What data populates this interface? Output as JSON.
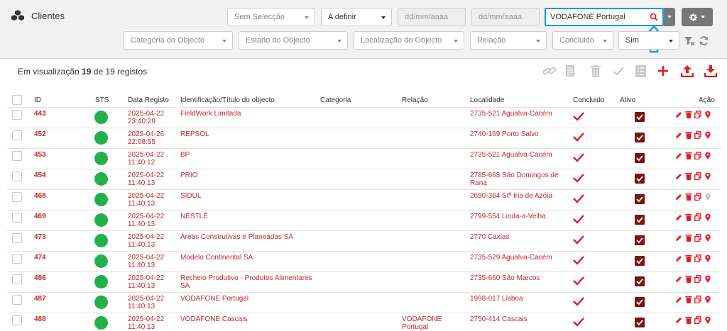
{
  "header": {
    "title": "Clientes",
    "filters_row1": {
      "sem_seleccao": "Sem Selecção",
      "a_definir": "A definir",
      "date_from_placeholder": "dd/mm/aaaa",
      "date_to_placeholder": "dd/mm/aaaa",
      "search_value": "VODAFONE Portugal"
    },
    "filters_row2": {
      "categoria": "Categoria do Objecto",
      "estado": "Estado do Objecto",
      "localizacao": "Localização do Objecto",
      "relacao": "Relação",
      "concluido": "Concluido",
      "sim": "Sim"
    }
  },
  "summary": {
    "prefix": "Em visualização",
    "shown": "19",
    "middle": "de 19 registos"
  },
  "columns": {
    "id": "ID",
    "sts": "STS",
    "data": "Data Registo",
    "ident": "Identificação/Título do objecto",
    "categoria": "Categoria",
    "relacao": "Relação",
    "localidade": "Localidade",
    "concluido": "Concluido",
    "ativo": "Ativo",
    "acao": "Ação"
  },
  "rows": [
    {
      "id": "443",
      "date": "2025-04-22",
      "time": "23:40:29",
      "ident": "FieldWork Limitada",
      "ident2": "",
      "relacao": "",
      "relacao2": "",
      "loc": "2735-521 Agualva-Cacém",
      "loc2": ""
    },
    {
      "id": "452",
      "date": "2025-04-26",
      "time": "22:08:55",
      "ident": "REPSOL",
      "ident2": "",
      "relacao": "",
      "relacao2": "",
      "loc": "2740-169 Porto Salvo",
      "loc2": ""
    },
    {
      "id": "453",
      "date": "2025-04-22",
      "time": "11:40:12",
      "ident": "BP",
      "ident2": "",
      "relacao": "",
      "relacao2": "",
      "loc": "2735-521 Agualva-Cacém",
      "loc2": ""
    },
    {
      "id": "454",
      "date": "2025-04-22",
      "time": "11:40:13",
      "ident": "PRIO",
      "ident2": "",
      "relacao": "",
      "relacao2": "",
      "loc": "2785-663 São Domingos de",
      "loc2": "Rana"
    },
    {
      "id": "468",
      "date": "2025-04-22",
      "time": "11:40:13",
      "ident": "SIDUL",
      "ident2": "",
      "relacao": "",
      "relacao2": "",
      "loc": "2690-364 Stª Iria de Azóia",
      "loc2": ""
    },
    {
      "id": "469",
      "date": "2025-04-22",
      "time": "11:40:13",
      "ident": "NESTLÉ",
      "ident2": "",
      "relacao": "",
      "relacao2": "",
      "loc": "2799-554 Linda-a-Velha",
      "loc2": ""
    },
    {
      "id": "473",
      "date": "2025-04-22",
      "time": "11:40:13",
      "ident": "Áreas Construtivas e Planeadas SA",
      "ident2": "",
      "relacao": "",
      "relacao2": "",
      "loc": "2770 Caxias",
      "loc2": ""
    },
    {
      "id": "474",
      "date": "2025-04-22",
      "time": "11:40:13",
      "ident": "Modelo Continental SA",
      "ident2": "",
      "relacao": "",
      "relacao2": "",
      "loc": "2735-529 Agualva-Cacém",
      "loc2": ""
    },
    {
      "id": "486",
      "date": "2025-04-22",
      "time": "11:40:13",
      "ident": "Recheio Produtivo - Produtos Alimentares",
      "ident2": "SA",
      "relacao": "",
      "relacao2": "",
      "loc": "2735-660 São Marcos",
      "loc2": ""
    },
    {
      "id": "487",
      "date": "2025-04-22",
      "time": "11:40:13",
      "ident": "VODAFONE Portugal",
      "ident2": "",
      "relacao": "",
      "relacao2": "",
      "loc": "1998-017 Lisboa",
      "loc2": ""
    },
    {
      "id": "488",
      "date": "2025-04-22",
      "time": "11:40:13",
      "ident": "VODAFONE Cascais",
      "ident2": "",
      "relacao": "VODAFONE",
      "relacao2": "Portugal",
      "loc": "2750-414 Cascais",
      "loc2": ""
    }
  ],
  "colors": {
    "accent_red": "#e31b23",
    "row_text": "#c62828",
    "status_green": "#22b04b",
    "ativo_box": "#7a1212",
    "search_border": "#1e9bd7"
  },
  "icons": {
    "toolbar": [
      "link-icon",
      "document-icon",
      "trash-icon",
      "check-icon",
      "list-icon",
      "plus-icon",
      "upload-icon",
      "download-icon"
    ],
    "row_actions": [
      "pencil-icon",
      "trash-icon",
      "copy-icon",
      "map-pin-icon"
    ]
  }
}
